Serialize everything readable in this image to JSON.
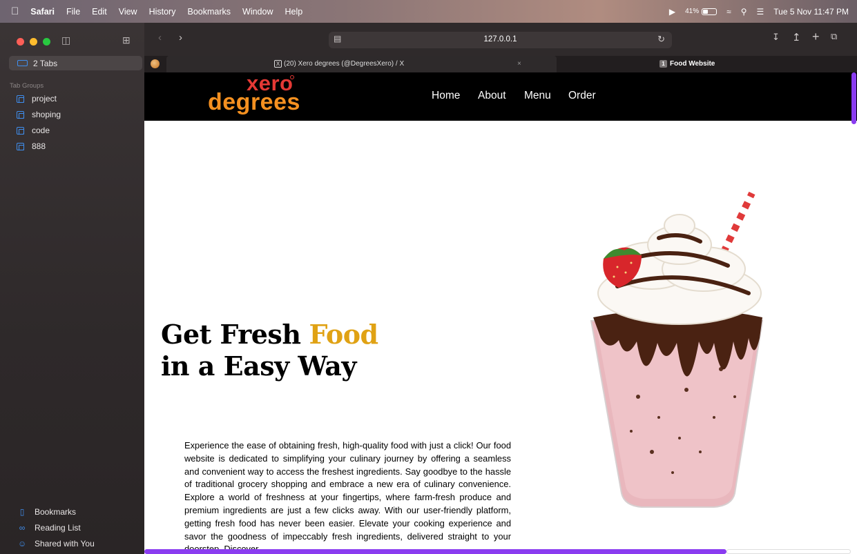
{
  "menubar": {
    "apple_icon": "apple-logo-icon",
    "items": [
      "Safari",
      "File",
      "Edit",
      "View",
      "History",
      "Bookmarks",
      "Window",
      "Help"
    ],
    "battery_percent": "41%",
    "battery_level": 0.41,
    "datetime": "Tue 5 Nov  11:47 PM"
  },
  "sidebar": {
    "tabs_label": "2 Tabs",
    "tab_groups_label": "Tab Groups",
    "groups": [
      "project",
      "shoping",
      "code",
      "888"
    ],
    "bottom": [
      "Bookmarks",
      "Reading List",
      "Shared with You"
    ]
  },
  "toolbar": {
    "address": "127.0.0.1"
  },
  "tabs": [
    {
      "title": "(20) Xero degrees (@DegreesXero) / X",
      "icon": "x-logo-icon"
    },
    {
      "title": "Food Website",
      "badge": "1"
    }
  ],
  "page": {
    "logo_top": "xero",
    "logo_bottom": "degrees",
    "nav": [
      "Home",
      "About",
      "Menu",
      "Order"
    ],
    "hero_line1": "Get Fresh",
    "hero_highlight": "Food",
    "hero_line2": "in a Easy Way",
    "hero_text": "Experience the ease of obtaining fresh, high-quality food with just a click! Our food website is dedicated to simplifying your culinary journey by offering a seamless and convenient way to access the freshest ingredients. Say goodbye to the hassle of traditional grocery shopping and embrace a new era of culinary convenience. Explore a world of freshness at your fingertips, where farm-fresh produce and premium ingredients are just a few clicks away. With our user-friendly platform, getting fresh food has never been easier. Elevate your cooking experience and savor the goodness of impeccably fresh ingredients, delivered straight to your doorstep. Discover",
    "colors": {
      "accent": "#e0a214",
      "logo_red": "#e53935",
      "logo_orange": "#f59020",
      "scroll": "#8a3cf0"
    }
  }
}
